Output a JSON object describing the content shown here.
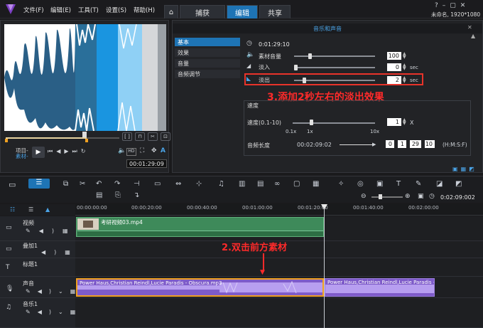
{
  "menu": [
    "文件(F)",
    "编辑(E)",
    "工具(T)",
    "设置(S)",
    "帮助(H)"
  ],
  "tabs": {
    "capture": "捕获",
    "edit": "编辑",
    "share": "共享"
  },
  "project": "未命名, 1920*1080",
  "player": {
    "project_label": "项目-",
    "clip_label": "素材-",
    "timecode": "00:01:29:09"
  },
  "options": {
    "title": "音乐和声音",
    "timecode": "0:01:29:10",
    "sidebar": [
      "基本",
      "效果",
      "音量",
      "音频调节"
    ],
    "clip_volume_label": "素材音量",
    "clip_volume": "100",
    "fade_in_label": "淡入",
    "fade_in": "0",
    "fade_out_label": "淡出",
    "fade_out": "2",
    "sec": "sec",
    "speed_section": "速度",
    "speed_label": "速度(0.1-10)",
    "speed_value": "1",
    "x_unit": "X",
    "ticks": [
      "0.1x",
      "1x",
      "10x"
    ],
    "duration_label": "音频长度",
    "duration_value": "00:02:09:02",
    "dur_h": "0",
    "dur_m": "1",
    "dur_s": "29",
    "dur_f": "10",
    "dur_format": "(H:M:S:F)"
  },
  "annotations": {
    "step3": "3.添加2秒左右的淡出效果",
    "step2": "2.双击前方素材"
  },
  "timeline": {
    "zoom_time": "0:02:09:002",
    "ruler": [
      "00:00:00:00",
      "00:00:20:00",
      "00:00:40:00",
      "00:01:00:00",
      "00:01:20:00",
      "00:01:40:00",
      "00:02:00:00"
    ],
    "tracks": [
      "视频",
      "叠加1",
      "标题1",
      "声音",
      "音乐1"
    ],
    "video_clip": "考研视频03.mp4",
    "audio_clip1": "Power Haus,Christian Reindl,Lucie Paradis - Obscura.mp3",
    "audio_clip2": "Power Haus,Christian Reindl,Lucie Paradis - Obs"
  }
}
